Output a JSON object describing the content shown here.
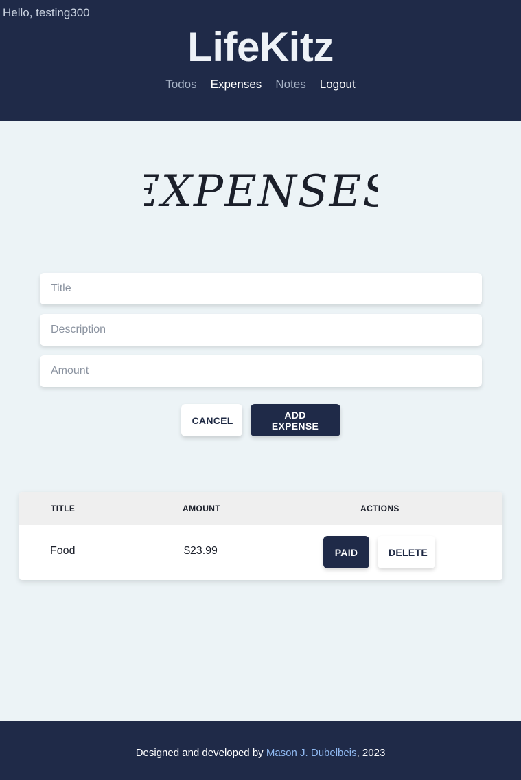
{
  "header": {
    "greeting": "Hello, testing300",
    "logo": "LifeKitz",
    "nav": [
      {
        "label": "Todos"
      },
      {
        "label": "Expenses"
      },
      {
        "label": "Notes"
      },
      {
        "label": "Logout"
      }
    ]
  },
  "main": {
    "page_title": "EXPENSES",
    "form": {
      "title_placeholder": "Title",
      "description_placeholder": "Description",
      "amount_placeholder": "Amount",
      "cancel_label": "CANCEL",
      "add_label": "ADD EXPENSE"
    },
    "table": {
      "columns": [
        "TITLE",
        "AMOUNT",
        "ACTIONS"
      ],
      "rows": [
        {
          "title": "Food",
          "amount": "$23.99",
          "paid_label": "PAID",
          "delete_label": "DELETE"
        }
      ]
    }
  },
  "footer": {
    "prefix": "Designed and developed by ",
    "author": "Mason J. Dubelbeis",
    "suffix": ", 2023"
  },
  "colors": {
    "header_bg": "#1f2a48",
    "page_bg": "#ecf3f6",
    "link_accent": "#8fb8f0"
  }
}
